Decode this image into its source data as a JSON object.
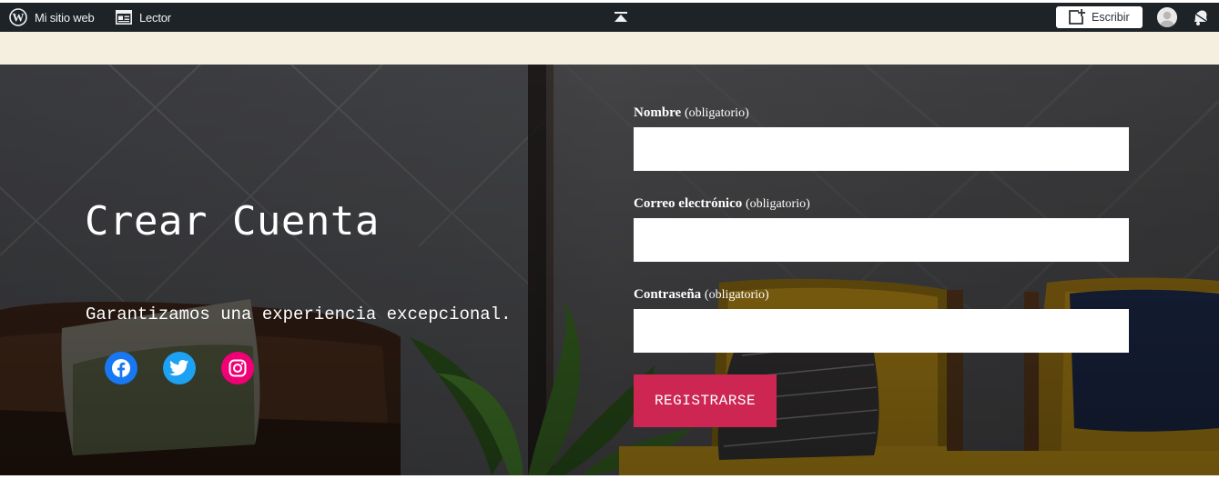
{
  "adminbar": {
    "my_site": "Mi sitio web",
    "reader": "Lector",
    "write": "Escribir",
    "icons": [
      "wordpress-icon",
      "reader-icon",
      "collapse-icon",
      "write-icon",
      "avatar",
      "bell-icon"
    ]
  },
  "hero": {
    "title": "Crear Cuenta",
    "tagline": "Garantizamos una experiencia excepcional.",
    "social": [
      "facebook-icon",
      "twitter-icon",
      "instagram-icon"
    ]
  },
  "form": {
    "name_label": "Nombre",
    "name_required": "(obligatorio)",
    "name_value": "",
    "email_label": "Correo electrónico",
    "email_required": "(obligatorio)",
    "email_value": "",
    "password_label": "Contraseña",
    "password_required": "(obligatorio)",
    "password_value": "",
    "submit": "REGISTRARSE"
  },
  "colors": {
    "adminbar": "#1d2327",
    "cream": "#f5efe0",
    "accent": "#cd2653",
    "facebook": "#1778f2",
    "twitter": "#1da1f2",
    "instagram": "#f00075"
  }
}
